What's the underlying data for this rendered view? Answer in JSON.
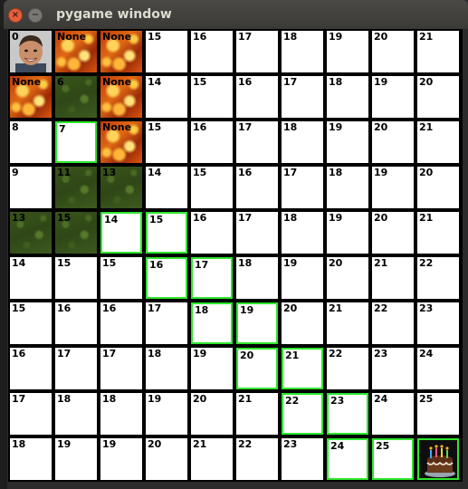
{
  "window": {
    "title": "pygame window",
    "close_glyph": "×",
    "minimize_glyph": "−"
  },
  "grid": {
    "columns": 10,
    "rows": 10,
    "rows_data": [
      [
        {
          "label": "0",
          "type": "avatar"
        },
        {
          "label": "None",
          "type": "fire"
        },
        {
          "label": "None",
          "type": "fire"
        },
        {
          "label": "15",
          "type": "empty"
        },
        {
          "label": "16",
          "type": "empty"
        },
        {
          "label": "17",
          "type": "empty"
        },
        {
          "label": "18",
          "type": "empty"
        },
        {
          "label": "19",
          "type": "empty"
        },
        {
          "label": "20",
          "type": "empty"
        },
        {
          "label": "21",
          "type": "empty"
        }
      ],
      [
        {
          "label": "None",
          "type": "fire"
        },
        {
          "label": "6",
          "type": "grass"
        },
        {
          "label": "None",
          "type": "fire"
        },
        {
          "label": "14",
          "type": "empty"
        },
        {
          "label": "15",
          "type": "empty"
        },
        {
          "label": "16",
          "type": "empty"
        },
        {
          "label": "17",
          "type": "empty"
        },
        {
          "label": "18",
          "type": "empty"
        },
        {
          "label": "19",
          "type": "empty"
        },
        {
          "label": "20",
          "type": "empty"
        }
      ],
      [
        {
          "label": "8",
          "type": "empty"
        },
        {
          "label": "7",
          "type": "empty",
          "path": true
        },
        {
          "label": "None",
          "type": "fire"
        },
        {
          "label": "15",
          "type": "empty"
        },
        {
          "label": "16",
          "type": "empty"
        },
        {
          "label": "17",
          "type": "empty"
        },
        {
          "label": "18",
          "type": "empty"
        },
        {
          "label": "19",
          "type": "empty"
        },
        {
          "label": "20",
          "type": "empty"
        },
        {
          "label": "21",
          "type": "empty"
        }
      ],
      [
        {
          "label": "9",
          "type": "empty"
        },
        {
          "label": "11",
          "type": "grass"
        },
        {
          "label": "13",
          "type": "grass"
        },
        {
          "label": "14",
          "type": "empty"
        },
        {
          "label": "15",
          "type": "empty"
        },
        {
          "label": "16",
          "type": "empty"
        },
        {
          "label": "17",
          "type": "empty"
        },
        {
          "label": "18",
          "type": "empty"
        },
        {
          "label": "19",
          "type": "empty"
        },
        {
          "label": "20",
          "type": "empty"
        }
      ],
      [
        {
          "label": "13",
          "type": "grass"
        },
        {
          "label": "15",
          "type": "grass"
        },
        {
          "label": "14",
          "type": "empty",
          "path": true
        },
        {
          "label": "15",
          "type": "empty",
          "path": true
        },
        {
          "label": "16",
          "type": "empty"
        },
        {
          "label": "17",
          "type": "empty"
        },
        {
          "label": "18",
          "type": "empty"
        },
        {
          "label": "19",
          "type": "empty"
        },
        {
          "label": "20",
          "type": "empty"
        },
        {
          "label": "21",
          "type": "empty"
        }
      ],
      [
        {
          "label": "14",
          "type": "empty"
        },
        {
          "label": "15",
          "type": "empty"
        },
        {
          "label": "15",
          "type": "empty"
        },
        {
          "label": "16",
          "type": "empty",
          "path": true
        },
        {
          "label": "17",
          "type": "empty",
          "path": true
        },
        {
          "label": "18",
          "type": "empty"
        },
        {
          "label": "19",
          "type": "empty"
        },
        {
          "label": "20",
          "type": "empty"
        },
        {
          "label": "21",
          "type": "empty"
        },
        {
          "label": "22",
          "type": "empty"
        }
      ],
      [
        {
          "label": "15",
          "type": "empty"
        },
        {
          "label": "16",
          "type": "empty"
        },
        {
          "label": "16",
          "type": "empty"
        },
        {
          "label": "17",
          "type": "empty"
        },
        {
          "label": "18",
          "type": "empty",
          "path": true
        },
        {
          "label": "19",
          "type": "empty",
          "path": true
        },
        {
          "label": "20",
          "type": "empty"
        },
        {
          "label": "21",
          "type": "empty"
        },
        {
          "label": "22",
          "type": "empty"
        },
        {
          "label": "23",
          "type": "empty"
        }
      ],
      [
        {
          "label": "16",
          "type": "empty"
        },
        {
          "label": "17",
          "type": "empty"
        },
        {
          "label": "17",
          "type": "empty"
        },
        {
          "label": "18",
          "type": "empty"
        },
        {
          "label": "19",
          "type": "empty"
        },
        {
          "label": "20",
          "type": "empty",
          "path": true
        },
        {
          "label": "21",
          "type": "empty",
          "path": true
        },
        {
          "label": "22",
          "type": "empty"
        },
        {
          "label": "23",
          "type": "empty"
        },
        {
          "label": "24",
          "type": "empty"
        }
      ],
      [
        {
          "label": "17",
          "type": "empty"
        },
        {
          "label": "18",
          "type": "empty"
        },
        {
          "label": "18",
          "type": "empty"
        },
        {
          "label": "19",
          "type": "empty"
        },
        {
          "label": "20",
          "type": "empty"
        },
        {
          "label": "21",
          "type": "empty"
        },
        {
          "label": "22",
          "type": "empty",
          "path": true
        },
        {
          "label": "23",
          "type": "empty",
          "path": true
        },
        {
          "label": "24",
          "type": "empty"
        },
        {
          "label": "25",
          "type": "empty"
        }
      ],
      [
        {
          "label": "18",
          "type": "empty"
        },
        {
          "label": "19",
          "type": "empty"
        },
        {
          "label": "19",
          "type": "empty"
        },
        {
          "label": "20",
          "type": "empty"
        },
        {
          "label": "21",
          "type": "empty"
        },
        {
          "label": "22",
          "type": "empty"
        },
        {
          "label": "23",
          "type": "empty"
        },
        {
          "label": "24",
          "type": "empty",
          "path": true
        },
        {
          "label": "25",
          "type": "empty",
          "path": true
        },
        {
          "label": "",
          "type": "goal",
          "path": true
        }
      ]
    ]
  },
  "colors": {
    "path_highlight": "#2ee62e",
    "grid_line": "#000000",
    "cell_bg": "#ffffff"
  },
  "icons": {
    "avatar": "person-face-icon",
    "goal": "birthday-cake-icon",
    "fire": "fire-tile",
    "grass": "grass-tile"
  }
}
